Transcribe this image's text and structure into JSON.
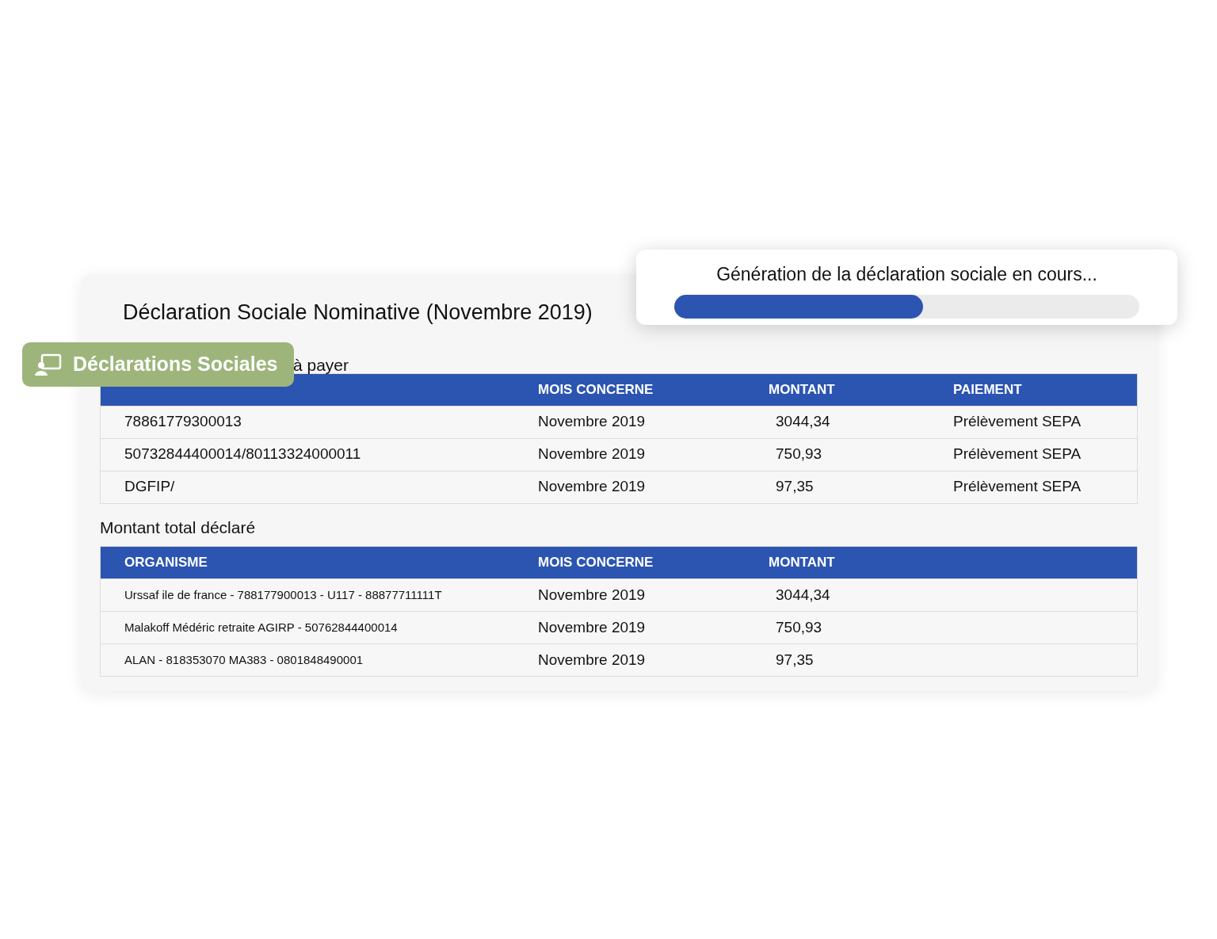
{
  "title": "Déclaration Sociale Nominative (Novembre 2019)",
  "badge": {
    "label": "Déclarations Sociales"
  },
  "progress": {
    "message": "Génération de la déclaration sociale en cours...",
    "level": 0.535
  },
  "payment_section": {
    "heading": "à payer",
    "columns": [
      "",
      "MOIS CONCERNE",
      "MONTANT",
      "PAIEMENT"
    ],
    "rows": [
      [
        "78861779300013",
        "Novembre 2019",
        "3044,34",
        "Prélèvement SEPA"
      ],
      [
        "50732844400014/80113324000011",
        "Novembre 2019",
        "750,93",
        "Prélèvement SEPA"
      ],
      [
        "DGFIP/",
        "Novembre 2019",
        "97,35",
        "Prélèvement SEPA"
      ]
    ]
  },
  "total_section": {
    "heading": "Montant total déclaré",
    "columns": [
      "ORGANISME",
      "MOIS CONCERNE",
      "MONTANT"
    ],
    "rows": [
      [
        "Urssaf ile de france - 788177900013 - U117 - 88877711111T",
        "Novembre 2019",
        "3044,34"
      ],
      [
        "Malakoff Médéric retraite AGIRP - 50762844400014",
        "Novembre 2019",
        "750,93"
      ],
      [
        "ALAN - 818353070 MA383 - 0801848490001",
        "Novembre 2019",
        "97,35"
      ]
    ]
  }
}
